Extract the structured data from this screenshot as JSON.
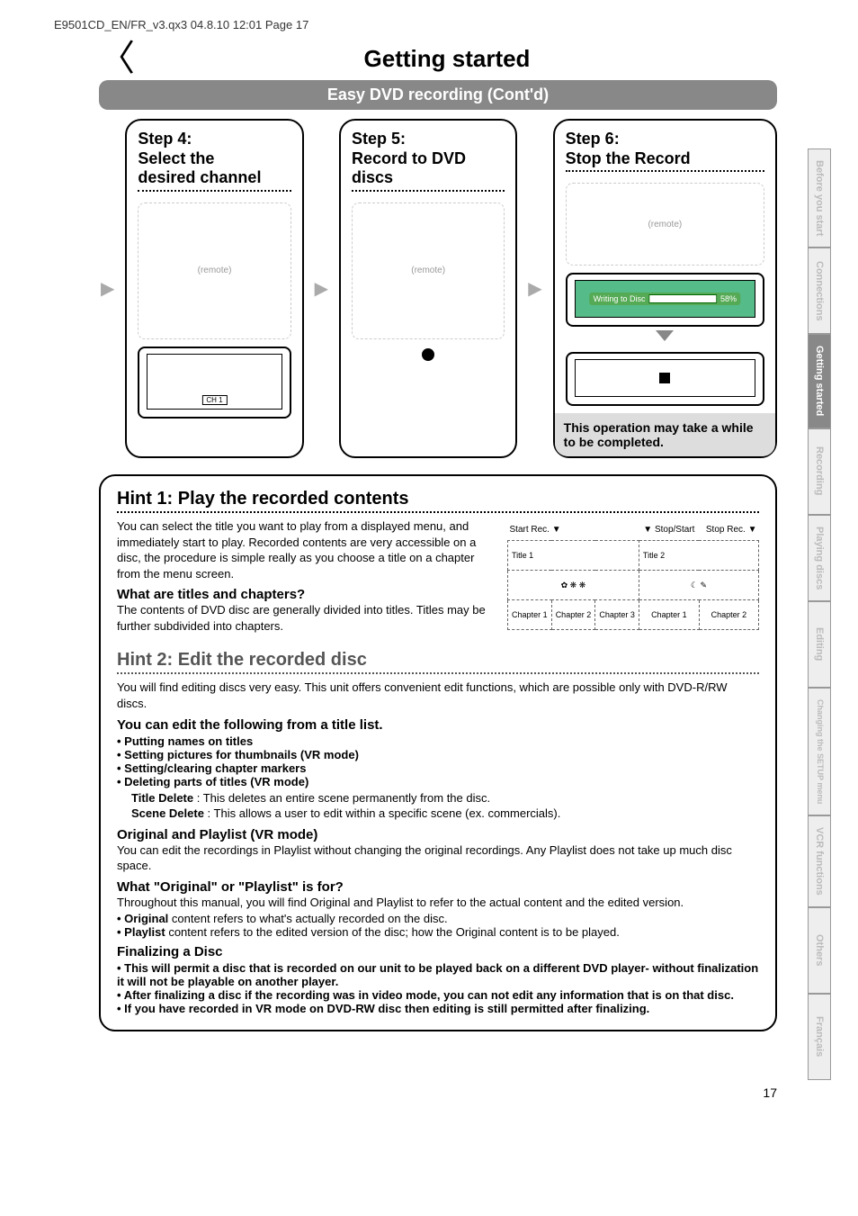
{
  "header_line": "E9501CD_EN/FR_v3.qx3  04.8.10  12:01  Page 17",
  "side_tabs": [
    {
      "label": "Before you start",
      "active": false
    },
    {
      "label": "Connections",
      "active": false
    },
    {
      "label": "Getting started",
      "active": true
    },
    {
      "label": "Recording",
      "active": false
    },
    {
      "label": "Playing discs",
      "active": false
    },
    {
      "label": "Editing",
      "active": false
    },
    {
      "label": "Changing the SETUP menu",
      "active": false
    },
    {
      "label": "VCR functions",
      "active": false
    },
    {
      "label": "Others",
      "active": false
    },
    {
      "label": "Français",
      "active": false
    }
  ],
  "main_title": "Getting started",
  "sub_banner": "Easy DVD recording (Cont'd)",
  "steps": {
    "step4": {
      "heading_line1": "Step 4:",
      "heading_line2": "Select the",
      "heading_line3": "desired channel",
      "tv_label": "CH 1"
    },
    "step5": {
      "heading_line1": "Step 5:",
      "heading_line2": "Record to DVD",
      "heading_line3": "discs"
    },
    "step6": {
      "heading_line1": "Step 6:",
      "heading_line2": "Stop the Record",
      "writing_text": "Writing to Disc",
      "writing_pct": "58%",
      "note": "This operation may take a while to be completed."
    }
  },
  "hint1": {
    "title": "Hint 1: Play the recorded contents",
    "para1": "You can select the title you want to play from a displayed menu, and immediately start to play. Recorded contents are very accessible on a disc, the procedure is simple really as you choose a title on a chapter from the menu screen.",
    "subhead": "What are titles and chapters?",
    "para2": "The contents of DVD disc are generally divided into titles. Titles may be further subdivided into chapters.",
    "diagram": {
      "start_rec": "Start Rec.",
      "stop_start": "Stop/Start",
      "stop_rec": "Stop Rec.",
      "title1": "Title 1",
      "title2": "Title 2",
      "chapters1": [
        "Chapter 1",
        "Chapter 2",
        "Chapter 3"
      ],
      "chapters2": [
        "Chapter 1",
        "Chapter 2"
      ]
    }
  },
  "hint2": {
    "title": "Hint 2: Edit the recorded disc",
    "para1": "You will find editing discs very easy. This unit offers convenient edit functions, which are possible only with DVD-R/RW discs.",
    "sub1": "You can edit the following from a title list.",
    "bullets1": [
      "Putting names on titles",
      "Setting pictures for thumbnails (VR mode)",
      "Setting/clearing chapter markers",
      "Deleting parts of titles (VR mode)"
    ],
    "title_delete_label": "Title Delete",
    "title_delete_desc": " : This deletes an entire scene permanently from the disc.",
    "scene_delete_label": "Scene Delete",
    "scene_delete_desc": " : This allows a user to edit within a specific scene (ex. commercials).",
    "sub2": "Original and Playlist (VR mode)",
    "para2": "You can edit the recordings in Playlist without changing the original recordings. Any Playlist does not take up much disc space.",
    "sub3": "What \"Original\" or \"Playlist\" is for?",
    "para3_intro": "Throughout this manual, you will find Original and Playlist to refer to the actual content and the edited version.",
    "bullets3": [
      {
        "bold": "Original",
        "rest": " content refers to what's actually recorded on the disc."
      },
      {
        "bold": "Playlist",
        "rest": " content refers to the edited version of the disc; how the Original content is to be played."
      }
    ],
    "sub4": "Finalizing a Disc",
    "bullets4": [
      "This will permit a disc that is recorded on our unit to be played back on a different DVD player- without finalization it will not be playable on another player.",
      "After finalizing a disc if the recording was in video mode, you can not edit any information that is on that disc.",
      "If you have recorded in VR mode on DVD-RW disc then editing is still permitted after finalizing."
    ]
  },
  "page_number": "17"
}
